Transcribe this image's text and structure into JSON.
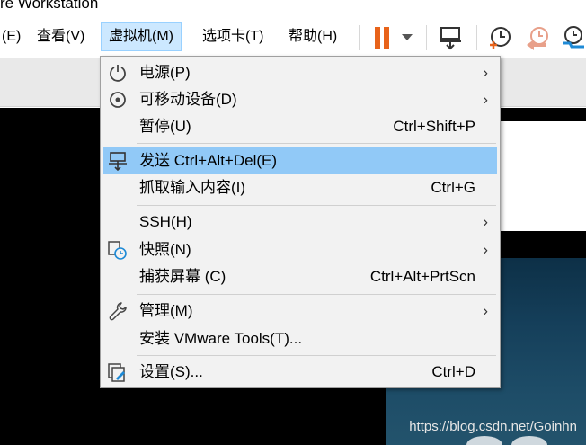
{
  "window": {
    "title": "re Workstation"
  },
  "menubar": {
    "items": [
      {
        "label": "(E)"
      },
      {
        "label": "查看(V)"
      },
      {
        "label": "虚拟机(M)"
      },
      {
        "label": "选项卡(T)"
      },
      {
        "label": "帮助(H)"
      }
    ]
  },
  "toolbar": {
    "pause_color": "#e8631a",
    "icons": [
      "pause-icon",
      "dropdown-arrow-icon",
      "send-ctrl-alt-del-icon",
      "take-snapshot-icon",
      "revert-snapshot-icon",
      "snapshot-manager-icon"
    ]
  },
  "dropdown": {
    "highlight_color": "#91c9f7",
    "items": [
      {
        "label": "电源(P)",
        "shortcut": "",
        "submenu": true,
        "icon": "power-icon"
      },
      {
        "label": "可移动设备(D)",
        "shortcut": "",
        "submenu": true,
        "icon": "removable-device-icon"
      },
      {
        "label": "暂停(U)",
        "shortcut": "Ctrl+Shift+P",
        "submenu": false,
        "icon": ""
      },
      {
        "label": "发送 Ctrl+Alt+Del(E)",
        "shortcut": "",
        "submenu": false,
        "icon": "send-keys-icon"
      },
      {
        "label": "抓取输入内容(I)",
        "shortcut": "Ctrl+G",
        "submenu": false,
        "icon": ""
      },
      {
        "label": "SSH(H)",
        "shortcut": "",
        "submenu": true,
        "icon": ""
      },
      {
        "label": "快照(N)",
        "shortcut": "",
        "submenu": true,
        "icon": "snapshot-icon"
      },
      {
        "label": "捕获屏幕 (C)",
        "shortcut": "Ctrl+Alt+PrtScn",
        "submenu": false,
        "icon": ""
      },
      {
        "label": "管理(M)",
        "shortcut": "",
        "submenu": true,
        "icon": "wrench-icon"
      },
      {
        "label": "安装 VMware Tools(T)...",
        "shortcut": "",
        "submenu": false,
        "icon": ""
      },
      {
        "label": "设置(S)...",
        "shortcut": "Ctrl+D",
        "submenu": false,
        "icon": "settings-icon"
      }
    ],
    "submenu_glyph": "›"
  },
  "watermark": "https://blog.csdn.net/Goinhn"
}
